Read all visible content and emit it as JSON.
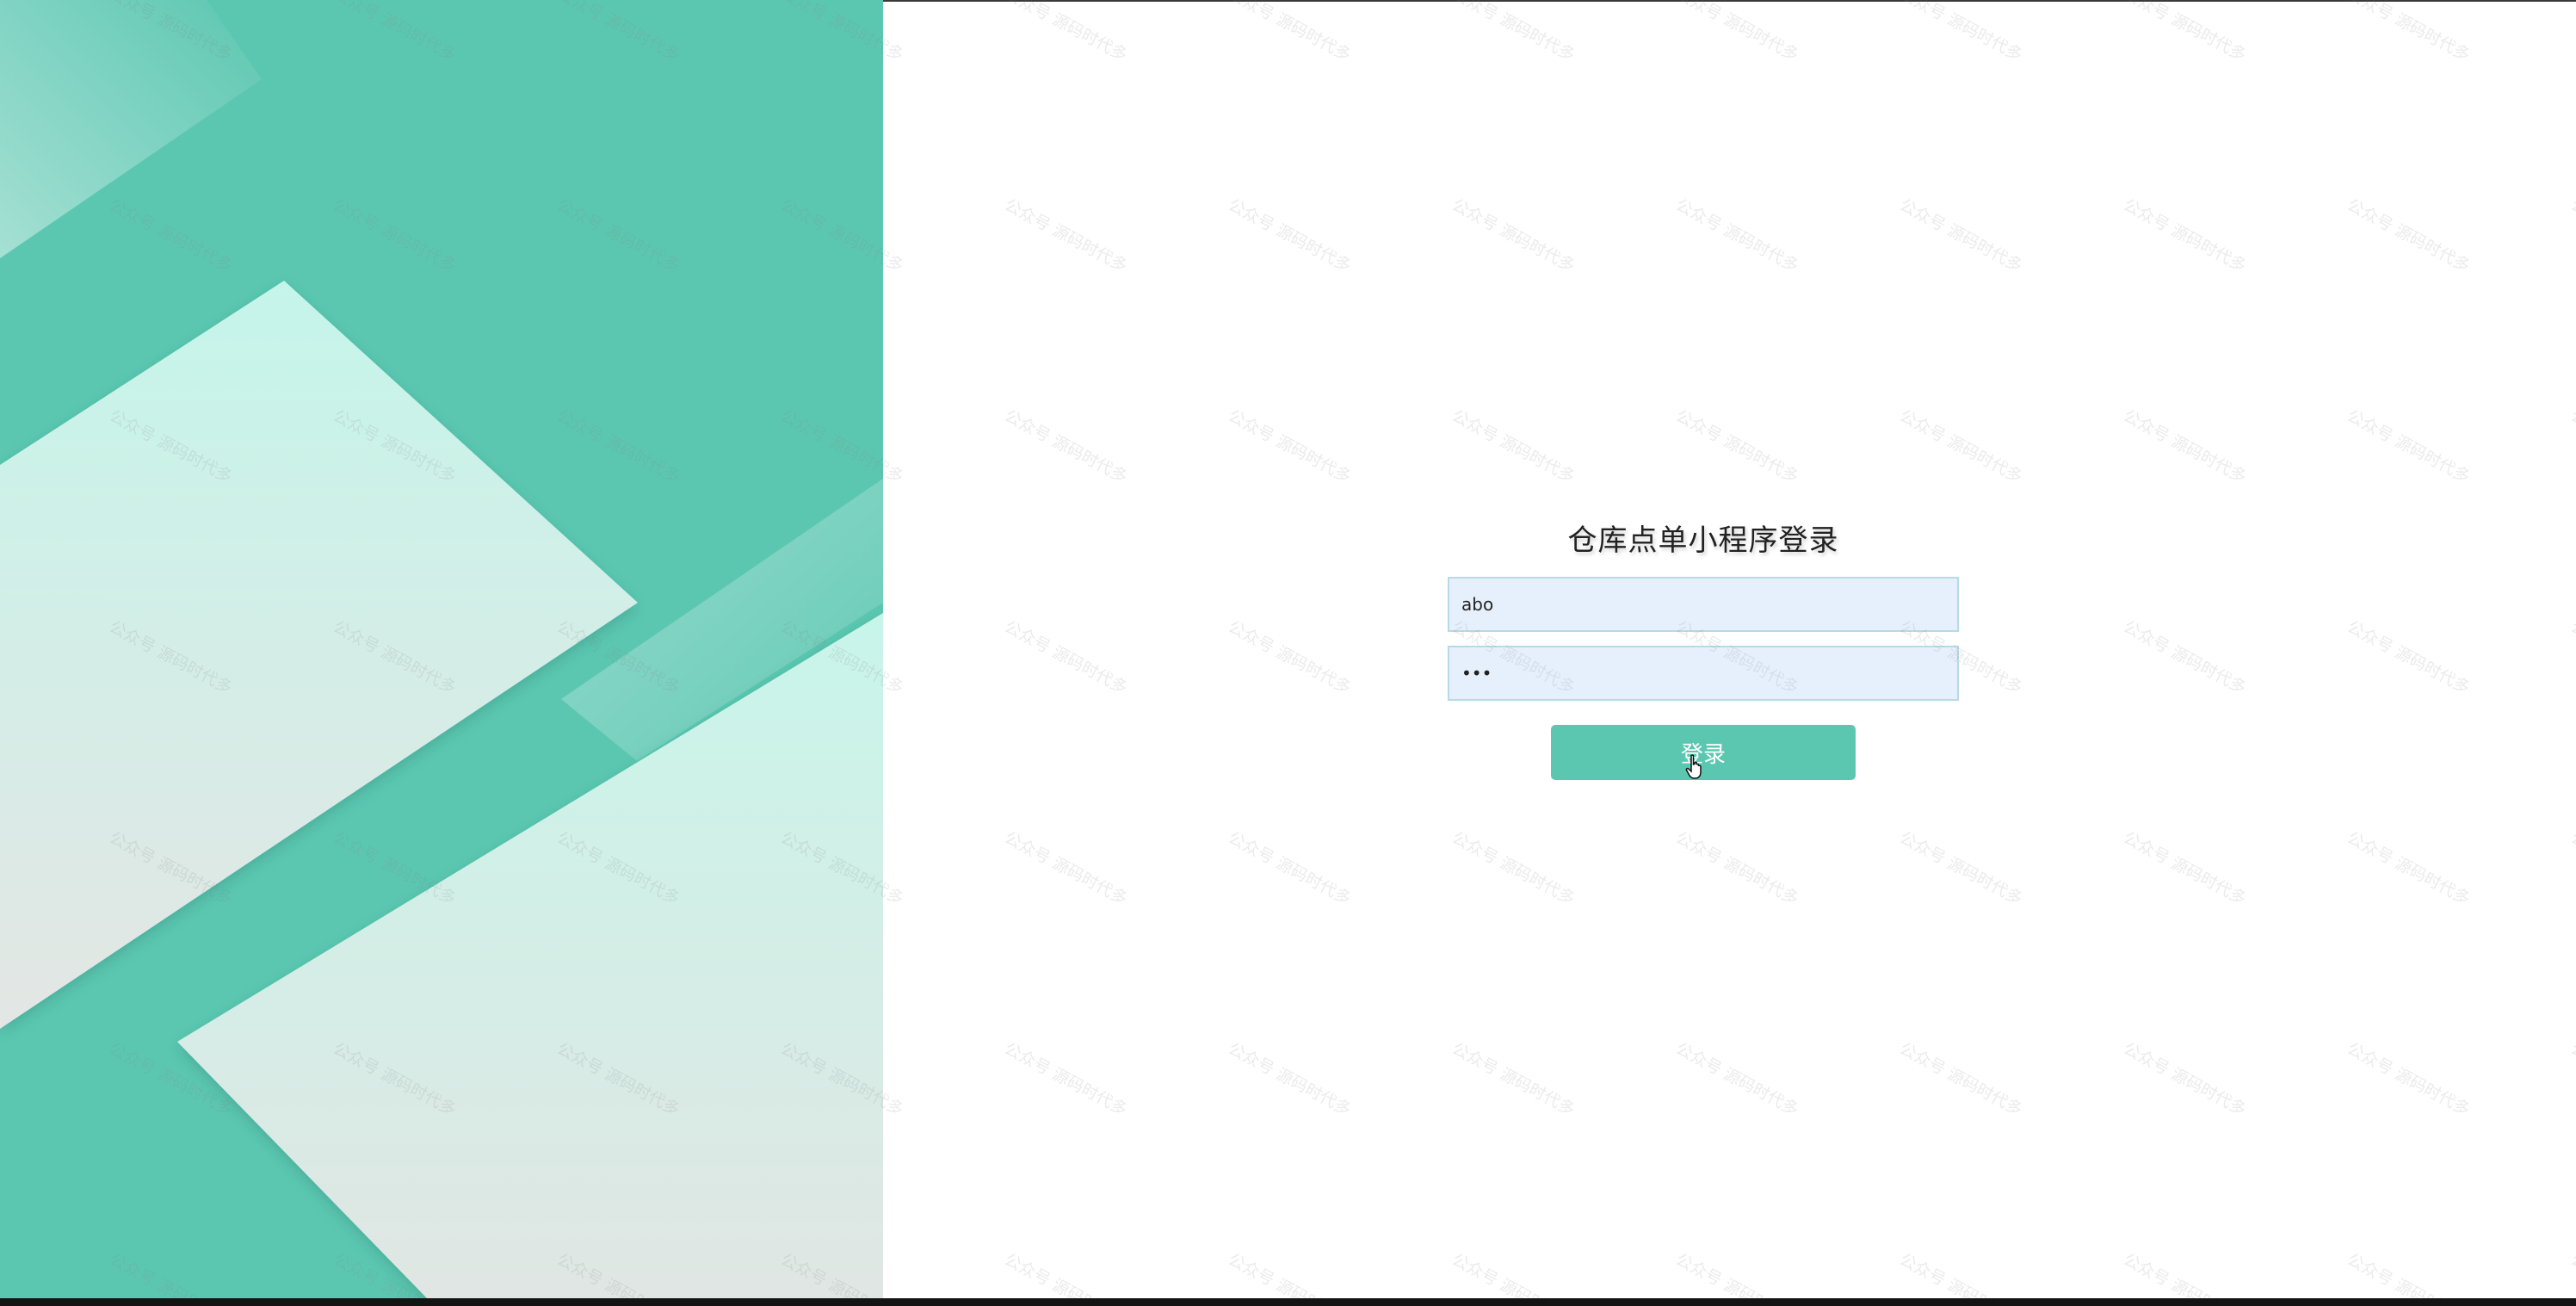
{
  "login": {
    "title": "仓库点单小程序登录",
    "username_value": "abo",
    "password_value": "abc",
    "button_label": "登录"
  },
  "watermark": {
    "text": "公众号 源码时代多"
  },
  "colors": {
    "accent": "#5cc7b1",
    "input_bg": "#e6f0fc",
    "input_border": "#b6dbe3"
  }
}
